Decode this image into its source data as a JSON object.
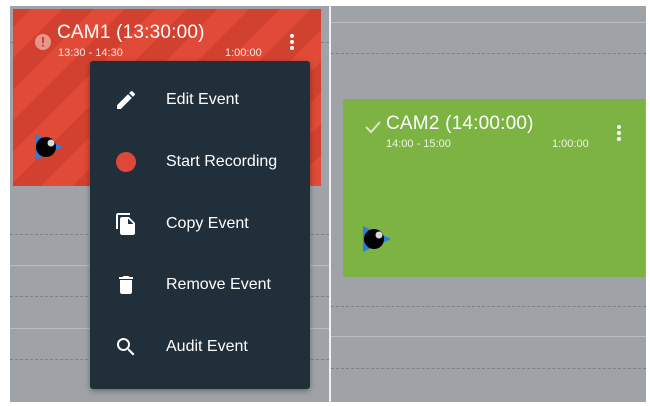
{
  "events": [
    {
      "title": "CAM1 (13:30:00)",
      "time_range": "13:30 - 14:30",
      "duration": "1:00:00",
      "status_icon": "info-icon",
      "color": "#e04a37"
    },
    {
      "title": "CAM2 (14:00:00)",
      "time_range": "14:00 - 15:00",
      "duration": "1:00:00",
      "status_icon": "check-icon",
      "color": "#7cb342"
    }
  ],
  "context_menu": {
    "background": "#212f3a",
    "items": [
      {
        "label": "Edit Event",
        "icon": "pencil-icon"
      },
      {
        "label": "Start Recording",
        "icon": "record-icon",
        "icon_color": "#e0463a"
      },
      {
        "label": "Copy Event",
        "icon": "copy-icon"
      },
      {
        "label": "Remove Event",
        "icon": "trash-icon"
      },
      {
        "label": "Audit Event",
        "icon": "search-icon"
      }
    ]
  }
}
